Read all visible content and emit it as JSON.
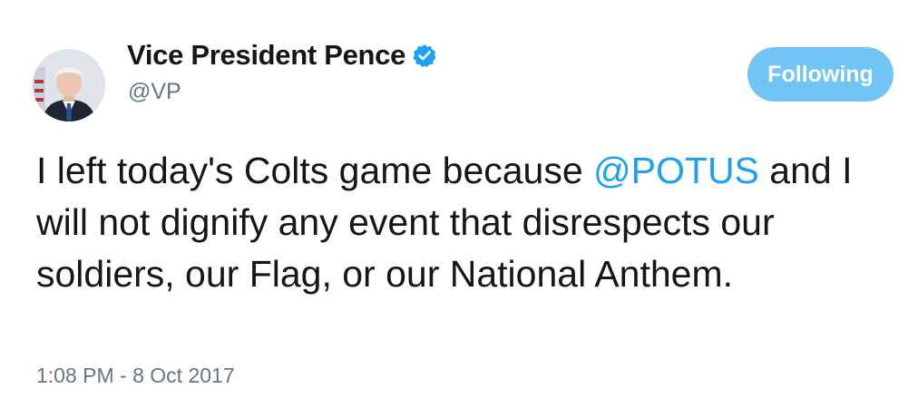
{
  "author": {
    "display_name": "Vice President Pence",
    "handle": "@VP",
    "verified": true
  },
  "follow_button": {
    "label": "Following"
  },
  "tweet": {
    "text_before": "I left today's Colts game because ",
    "mention": "@POTUS",
    "text_after": " and I will not dignify any event that disrespects our soldiers, our Flag, or our National Anthem."
  },
  "timestamp": "1:08 PM - 8 Oct 2017",
  "colors": {
    "accent": "#1da1f2",
    "text": "#14171a",
    "secondary_text": "#657786"
  },
  "icons": {
    "verified": "verified-badge-icon",
    "avatar": "profile-photo"
  }
}
